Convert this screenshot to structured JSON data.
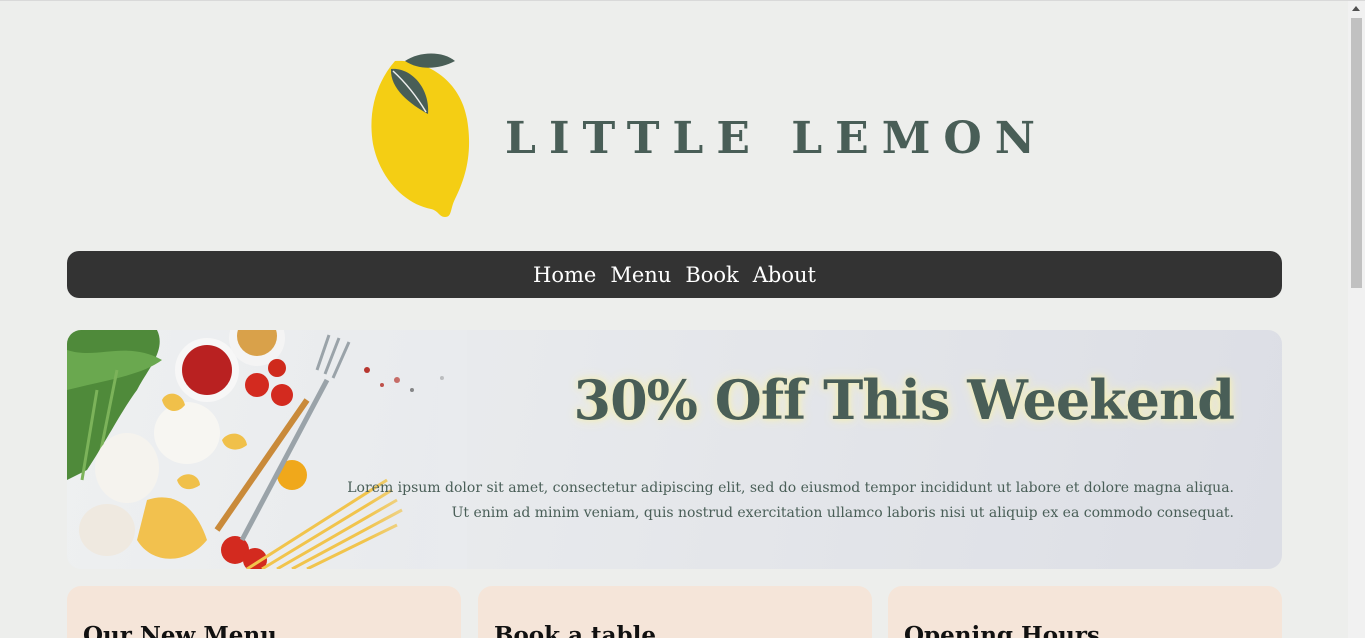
{
  "brand": {
    "name": "LITTLE LEMON",
    "lemon_color": "#f4ce14",
    "leaf_color": "#495e57"
  },
  "nav": {
    "items": [
      "Home",
      "Menu",
      "Book",
      "About"
    ],
    "background": "#333333"
  },
  "hero": {
    "title": "30% Off This Weekend",
    "text": "Lorem ipsum dolor sit amet, consectetur adipiscing elit, sed do eiusmod tempor incididunt ut labore et dolore magna aliqua. Ut enim ad minim veniam, quis nostrud exercitation ullamco laboris nisi ut aliquip ex ea commodo consequat."
  },
  "cards": [
    {
      "title": "Our New Menu"
    },
    {
      "title": "Book a table"
    },
    {
      "title": "Opening Hours"
    }
  ],
  "colors": {
    "primary": "#495e57",
    "card_bg": "#f5e5d9",
    "page_bg": "#edeeec"
  }
}
